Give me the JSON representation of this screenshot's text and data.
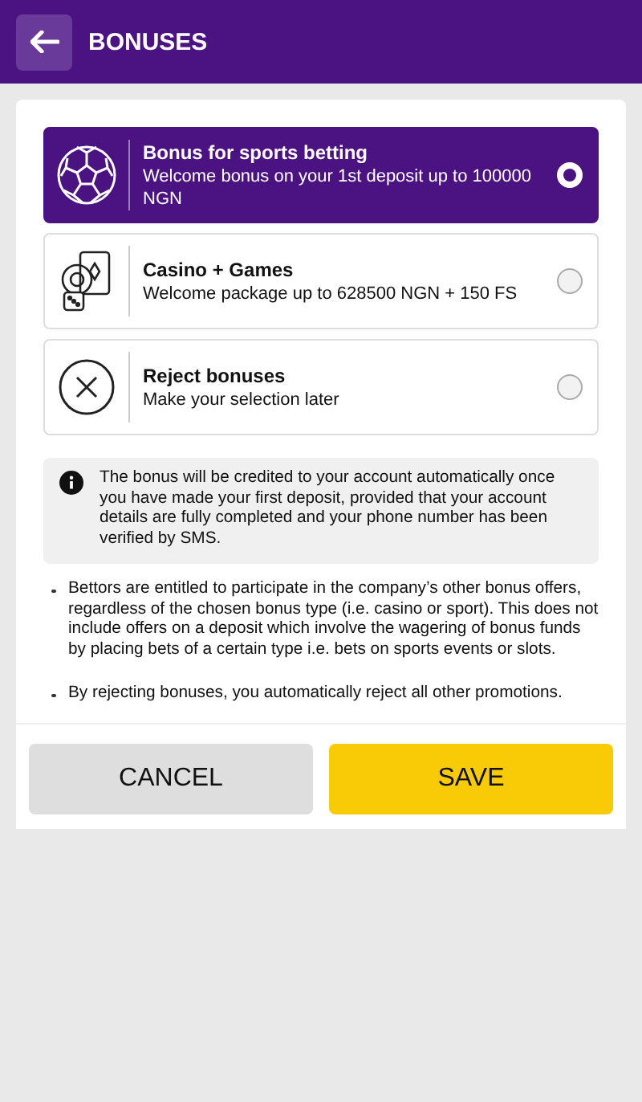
{
  "header": {
    "title": "BONUSES"
  },
  "options": [
    {
      "kind": "ball",
      "title": "Bonus for sports betting",
      "subtitle": "Welcome bonus on your 1st deposit up to 100000 NGN",
      "selected": true
    },
    {
      "kind": "casino",
      "title": "Casino + Games",
      "subtitle": "Welcome package up to 628500 NGN + 150 FS",
      "selected": false
    },
    {
      "kind": "reject",
      "title": "Reject bonuses",
      "subtitle": "Make your selection later",
      "selected": false
    }
  ],
  "info": "The bonus will be credited to your account automatically once you have made your first deposit, provided that your account details are fully completed and your phone number has been verified by SMS.",
  "notes": [
    "Bettors are entitled to participate in the company’s other bonus offers, regardless of the chosen bonus type (i.e. casino or sport). This does not include offers on a deposit which involve the wagering of bonus funds by placing bets of a certain type i.e. bets on sports events or slots.",
    "By rejecting bonuses, you automatically reject all other promotions."
  ],
  "buttons": {
    "cancel": "CANCEL",
    "save": "SAVE"
  }
}
